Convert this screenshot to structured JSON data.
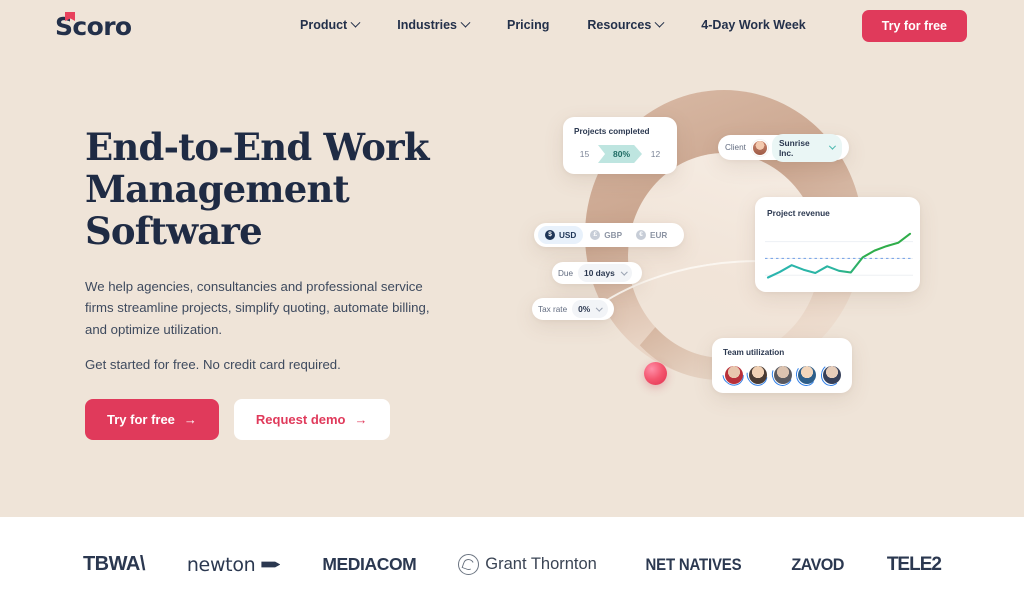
{
  "header": {
    "logo_text": "Scoro",
    "nav": [
      {
        "label": "Product",
        "has_chevron": true
      },
      {
        "label": "Industries",
        "has_chevron": true
      },
      {
        "label": "Pricing",
        "has_chevron": false
      },
      {
        "label": "Resources",
        "has_chevron": true
      },
      {
        "label": "4-Day Work Week",
        "has_chevron": false
      }
    ],
    "cta_label": "Try for free"
  },
  "hero": {
    "headline_line1": "End-to-End Work",
    "headline_line2": "Management Software",
    "paragraph": "We help agencies, consultancies and professional service firms streamline projects, simplify quoting, automate billing, and optimize utilization.",
    "subnote": "Get started for free. No credit card required.",
    "primary_cta": "Try for free",
    "primary_cta_arrow": "→",
    "secondary_cta": "Request demo",
    "secondary_cta_arrow": "→"
  },
  "illustration": {
    "projects_card": {
      "title": "Projects completed",
      "left_value": "15",
      "highlight_value": "80%",
      "right_value": "12"
    },
    "client_card": {
      "label": "Client",
      "value": "Sunrise Inc.",
      "avatar_icon": "user-avatar"
    },
    "currency_card": {
      "options": [
        {
          "code": "USD",
          "symbol": "$",
          "selected": true
        },
        {
          "code": "GBP",
          "symbol": "£",
          "selected": false
        },
        {
          "code": "EUR",
          "symbol": "€",
          "selected": false
        }
      ]
    },
    "due_card": {
      "label": "Due",
      "value": "10 days"
    },
    "tax_card": {
      "label": "Tax rate",
      "value": "0%"
    },
    "revenue_card": {
      "title": "Project revenue"
    },
    "team_card": {
      "title": "Team utilization",
      "avatar_count": 5
    }
  },
  "chart_data": {
    "type": "line",
    "title": "Project revenue",
    "xlabel": "",
    "ylabel": "",
    "x": [
      0,
      1,
      2,
      3,
      4,
      5,
      6,
      7,
      8,
      9,
      10,
      11,
      12
    ],
    "series": [
      {
        "name": "Project revenue",
        "values": [
          8,
          18,
          30,
          22,
          16,
          28,
          20,
          17,
          44,
          56,
          64,
          70,
          86
        ],
        "color_start": "#2BB5B0",
        "color_end": "#2FAD4A"
      }
    ],
    "target_line": {
      "value": 42,
      "style": "dotted",
      "color": "#7FA8E8"
    },
    "gridlines": [
      12,
      42,
      72
    ],
    "ylim": [
      0,
      100
    ],
    "grid": true,
    "legend": "none"
  },
  "logos": [
    {
      "name": "TBWA",
      "text": "TBWA\\"
    },
    {
      "name": "newton",
      "text": "newton"
    },
    {
      "name": "MEDIACOM",
      "text": "MEDIACOM"
    },
    {
      "name": "Grant Thornton",
      "text": "Grant Thornton"
    },
    {
      "name": "NET NATIVES",
      "text": "NET NATIVES"
    },
    {
      "name": "ZAVOD",
      "text": "ZAVOD"
    },
    {
      "name": "TELE2",
      "text": "TELE2"
    }
  ],
  "colors": {
    "hero_background": "#EFE4D8",
    "accent_pink": "#E03A5B",
    "navy": "#1F2B44",
    "teal": "#2BB5B0",
    "green": "#2FAD4A"
  }
}
